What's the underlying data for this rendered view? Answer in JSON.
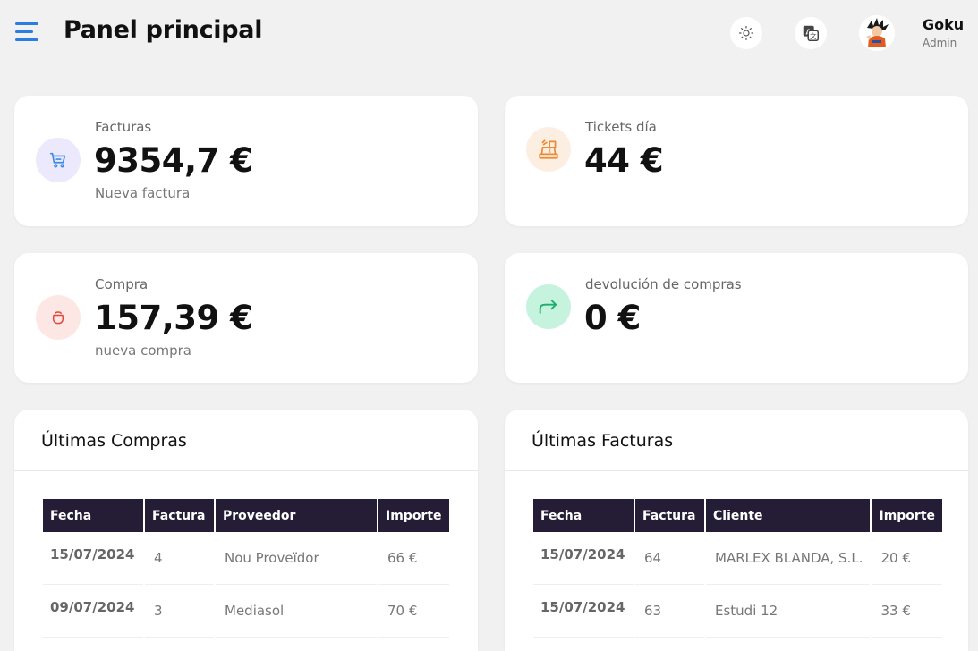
{
  "header": {
    "title": "Panel principal",
    "user_name": "Goku",
    "user_role": "Admin",
    "accent_color": "#2a7de1"
  },
  "stats": [
    {
      "label": "Facturas",
      "value": "9354,7 €",
      "sub": "Nueva factura",
      "icon": "cart-icon",
      "icon_color": "#3d8be6",
      "icon_bg": "#ebe9fb"
    },
    {
      "label": "Tickets día",
      "value": "44 €",
      "sub": "",
      "icon": "cash-register-icon",
      "icon_color": "#ec8a35",
      "icon_bg": "#fdeee2"
    },
    {
      "label": "Compra",
      "value": "157,39 €",
      "sub": "nueva compra",
      "icon": "bag-icon",
      "icon_color": "#e0463a",
      "icon_bg": "#fde7e4"
    },
    {
      "label": "devolución de compras",
      "value": "0 €",
      "sub": "",
      "icon": "share-arrow-icon",
      "icon_color": "#1fae6c",
      "icon_bg": "#c6f3dd"
    }
  ],
  "compras": {
    "title": "Últimas Compras",
    "columns": [
      "Fecha",
      "Factura",
      "Proveedor",
      "Importe"
    ],
    "rows": [
      {
        "fecha": "15/07/2024",
        "factura": "4",
        "proveedor": "Nou Proveïdor",
        "importe": "66 €"
      },
      {
        "fecha": "09/07/2024",
        "factura": "3",
        "proveedor": "Mediasol",
        "importe": "70 €"
      }
    ]
  },
  "facturas": {
    "title": "Últimas Facturas",
    "columns": [
      "Fecha",
      "Factura",
      "Cliente",
      "Importe"
    ],
    "rows": [
      {
        "fecha": "15/07/2024",
        "factura": "64",
        "cliente": "MARLEX BLANDA, S.L.",
        "importe": "20 €"
      },
      {
        "fecha": "15/07/2024",
        "factura": "63",
        "cliente": "Estudi 12",
        "importe": "33 €"
      }
    ]
  },
  "colors": {
    "table_header_bg": "#251d35",
    "page_bg": "#f1f1f1"
  }
}
